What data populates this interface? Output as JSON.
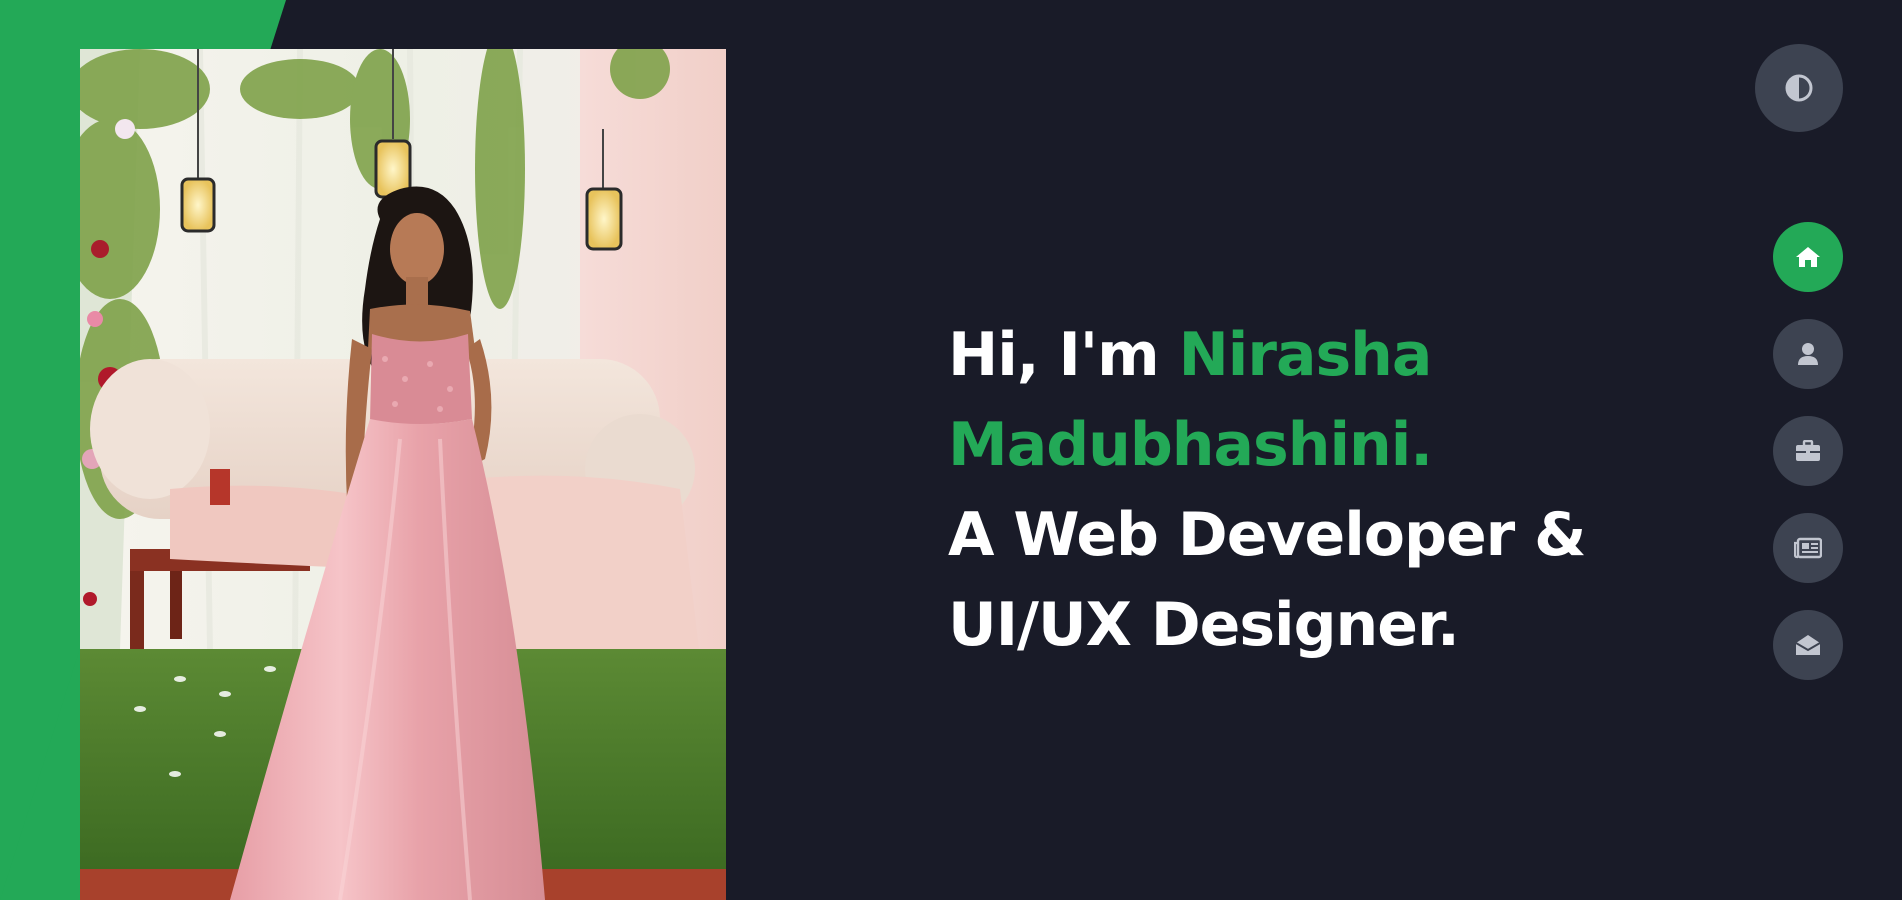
{
  "hero": {
    "greeting": "Hi, I'm ",
    "name_first": "Nirasha",
    "name_last": "Madubhashini.",
    "role_line1": "A Web Developer &",
    "role_line2": "UI/UX Designer."
  },
  "profile_photo": {
    "alt": "Nirasha Madubhashini"
  },
  "theme_toggle": {
    "icon": "contrast-icon",
    "label": "Toggle theme"
  },
  "nav": {
    "items": [
      {
        "icon": "home-icon",
        "label": "Home",
        "active": true
      },
      {
        "icon": "user-icon",
        "label": "About",
        "active": false
      },
      {
        "icon": "briefcase-icon",
        "label": "Portfolio",
        "active": false
      },
      {
        "icon": "newspaper-icon",
        "label": "Blog",
        "active": false
      },
      {
        "icon": "envelope-open-icon",
        "label": "Contact",
        "active": false
      }
    ]
  },
  "colors": {
    "background": "#191b28",
    "accent": "#23a957",
    "button": "#3d4351",
    "icon": "#c2c6d0",
    "text": "#ffffff"
  }
}
